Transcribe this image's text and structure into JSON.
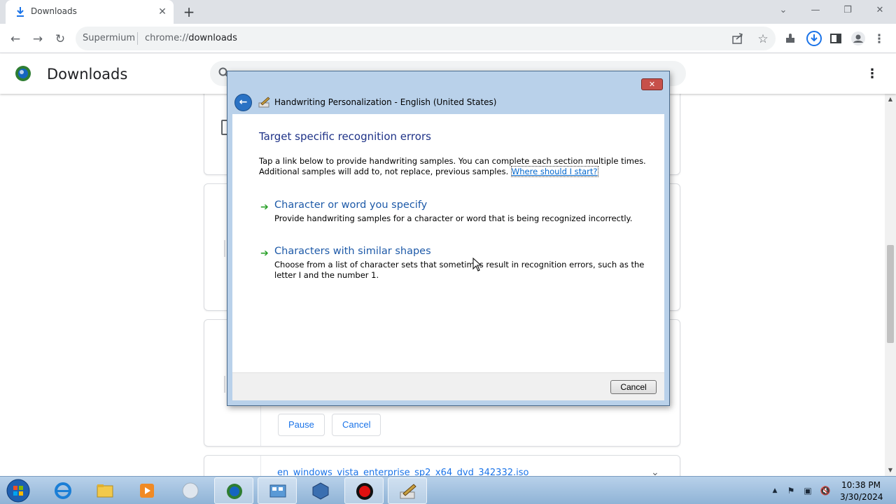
{
  "browser": {
    "tab": {
      "title": "Downloads",
      "icon": "download-icon",
      "close_icon": "close-icon"
    },
    "new_tab_icon": "plus-icon",
    "window_controls": {
      "dropdown": "chevron-down-icon",
      "minimize": "minimize-icon",
      "restore": "restore-icon",
      "close": "close-icon"
    },
    "toolbar": {
      "back_icon": "back-arrow-icon",
      "forward_icon": "forward-arrow-icon",
      "reload_icon": "reload-icon",
      "site_name": "Supermium",
      "url_scheme": "chrome://",
      "url_host": "downloads",
      "right_icons": [
        "share-icon",
        "bookmark-star-icon",
        "extensions-icon",
        "downloads-indicator-icon",
        "side-panel-icon",
        "profile-icon",
        "kebab-menu-icon"
      ]
    }
  },
  "downloads_page": {
    "title": "Downloads",
    "logo_icon": "supermium-logo-icon",
    "search_icon": "search-icon",
    "menu_icon": "kebab-menu-icon",
    "cards": [
      {
        "name": "",
        "buttons": []
      },
      {
        "name": "",
        "buttons": []
      },
      {
        "name": "",
        "buttons": [
          "Pause",
          "Cancel"
        ]
      },
      {
        "name": "en_windows_vista_enterprise_sp2_x64_dvd_342332.iso",
        "buttons": []
      }
    ]
  },
  "dialog": {
    "title": "Handwriting Personalization - English (United States)",
    "close_icon": "close-icon",
    "back_icon": "back-arrow-icon",
    "heading": "Target specific recognition errors",
    "intro_text": "Tap a link below to provide handwriting samples. You can complete each section multiple times. Additional samples will add to, not replace, previous samples.",
    "help_link": "Where should I start?",
    "tasks": [
      {
        "title": "Character or word you specify",
        "description": "Provide handwriting samples for a character or word that is being recognized incorrectly."
      },
      {
        "title": "Characters with similar shapes",
        "description": "Choose from a list of character sets that sometimes result in recognition errors, such as the letter I and the number 1."
      }
    ],
    "cancel_label": "Cancel"
  },
  "taskbar": {
    "start_icon": "windows-start-icon",
    "items": [
      "internet-explorer-icon",
      "file-explorer-icon",
      "media-player-icon",
      "orb-icon",
      "supermium-icon",
      "control-panel-icon",
      "virtualbox-icon",
      "record-icon",
      "handwriting-icon"
    ],
    "tray_icons": [
      "show-hidden-icons-icon",
      "action-center-flag-icon",
      "network-icon",
      "volume-muted-icon"
    ],
    "time": "10:38 PM",
    "date": "3/30/2024"
  },
  "colors": {
    "accent_blue": "#1a73e8",
    "dialog_frame": "#b9d1ea",
    "dialog_heading": "#1e3287",
    "task_arrow": "#2aa12a"
  }
}
